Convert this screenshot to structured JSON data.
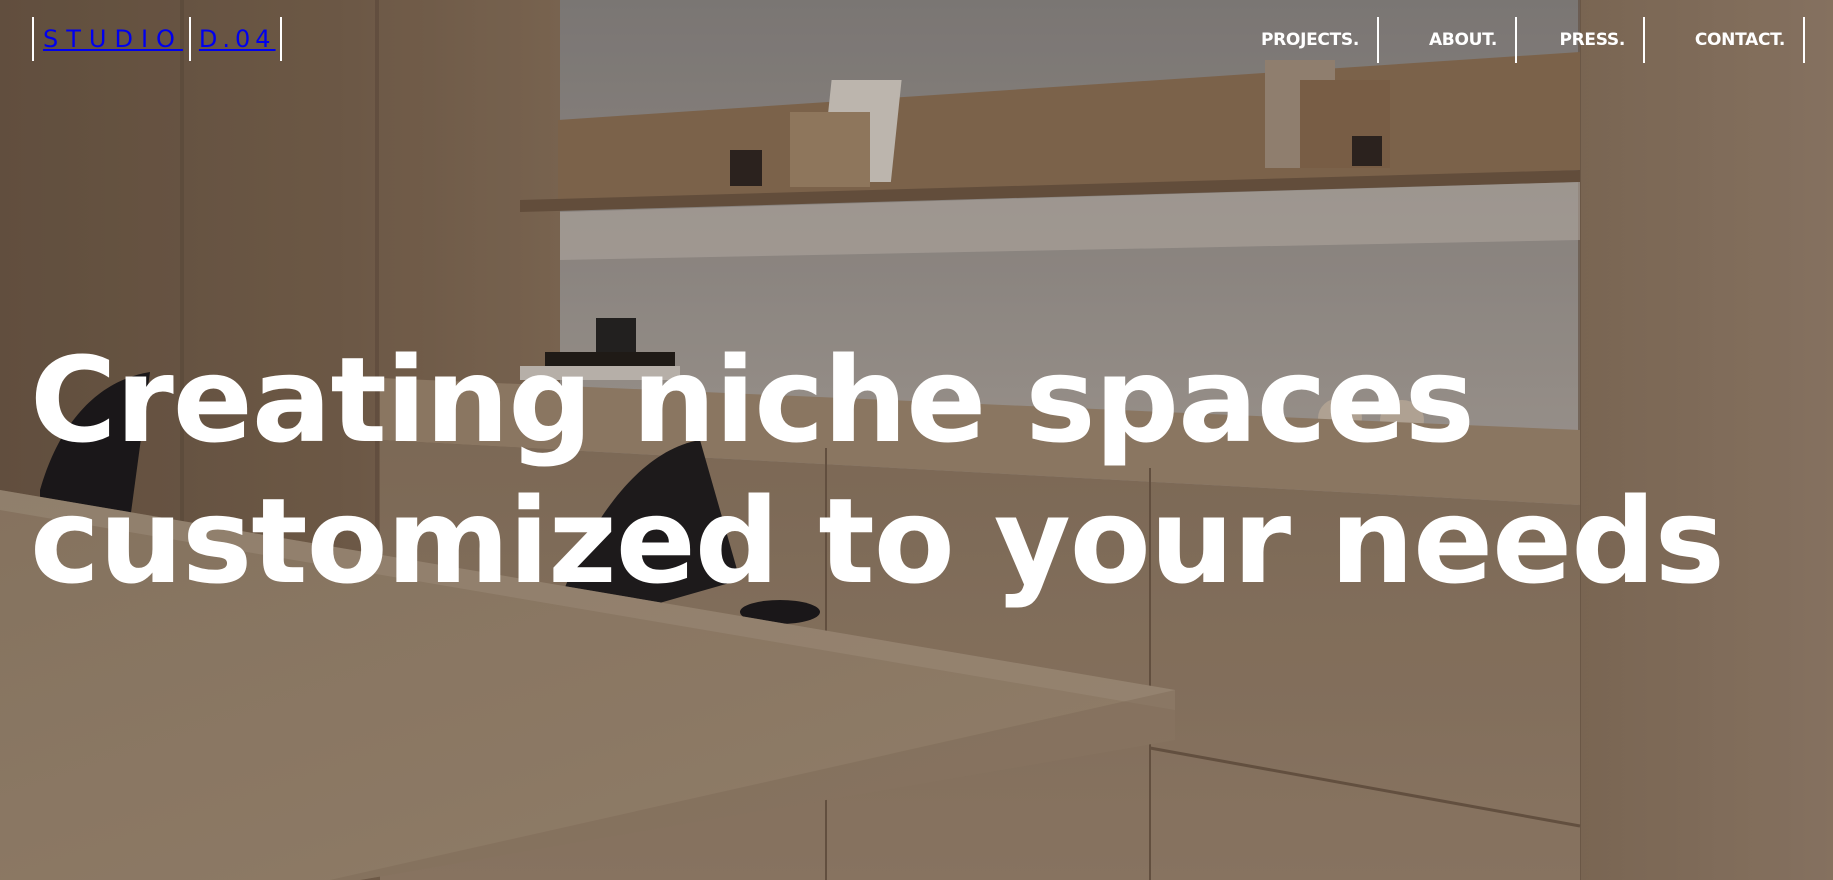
{
  "brand": {
    "left": "STUDIO",
    "right": "D.04"
  },
  "nav": {
    "items": [
      {
        "label": "PROJECTS."
      },
      {
        "label": "ABOUT."
      },
      {
        "label": "PRESS."
      },
      {
        "label": "CONTACT."
      }
    ]
  },
  "hero": {
    "headline_line1": "Creating niche spaces",
    "headline_line2": "customized to your needs"
  },
  "colors": {
    "text": "#ffffff",
    "wood": "#9c8065",
    "wall": "#a9a39c"
  }
}
